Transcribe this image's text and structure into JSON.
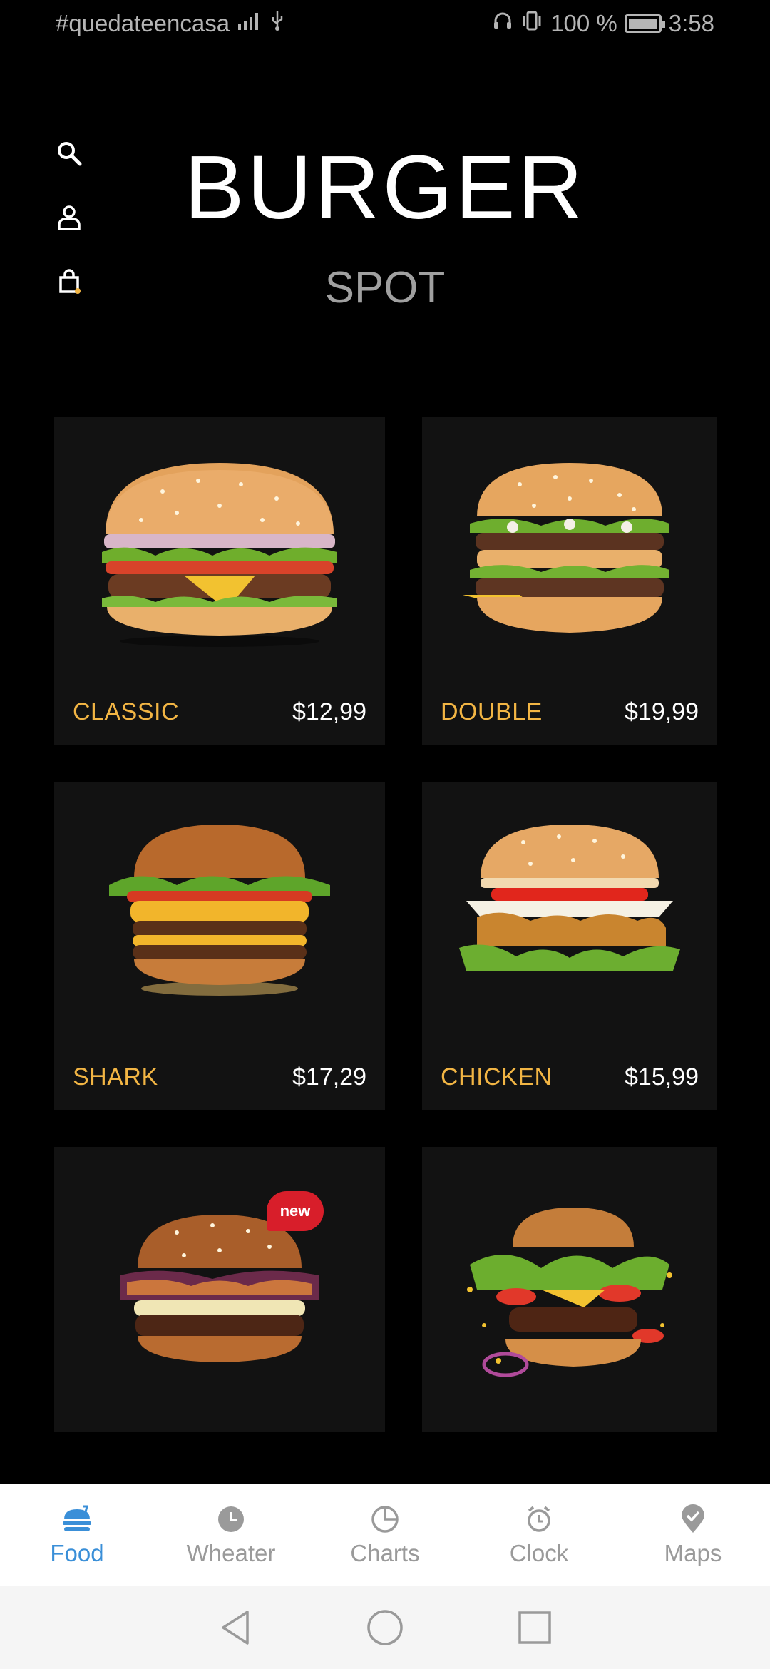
{
  "status_bar": {
    "hashtag": "#quedateencasa",
    "battery": "100 %",
    "time": "3:58"
  },
  "header": {
    "title": "BURGER",
    "subtitle": "SPOT"
  },
  "side_icons": [
    "search-icon",
    "user-icon",
    "cart-icon"
  ],
  "products": [
    {
      "name": "CLASSIC",
      "price": "$12,99",
      "style": "classic"
    },
    {
      "name": "DOUBLE",
      "price": "$19,99",
      "style": "double"
    },
    {
      "name": "SHARK",
      "price": "$17,29",
      "style": "shark"
    },
    {
      "name": "CHICKEN",
      "price": "$15,99",
      "style": "chicken"
    },
    {
      "name": "",
      "price": "",
      "style": "new",
      "badge": "new"
    },
    {
      "name": "",
      "price": "",
      "style": "exploded"
    }
  ],
  "bottom_nav": {
    "items": [
      {
        "label": "Food",
        "icon": "food-icon",
        "active": true
      },
      {
        "label": "Wheater",
        "icon": "clock-dial-icon",
        "active": false
      },
      {
        "label": "Charts",
        "icon": "pie-chart-icon",
        "active": false
      },
      {
        "label": "Clock",
        "icon": "alarm-clock-icon",
        "active": false
      },
      {
        "label": "Maps",
        "icon": "map-pin-icon",
        "active": false
      }
    ]
  },
  "colors": {
    "accent": "#f2b544",
    "active_nav": "#3a8fd8",
    "card_bg": "#121212"
  }
}
